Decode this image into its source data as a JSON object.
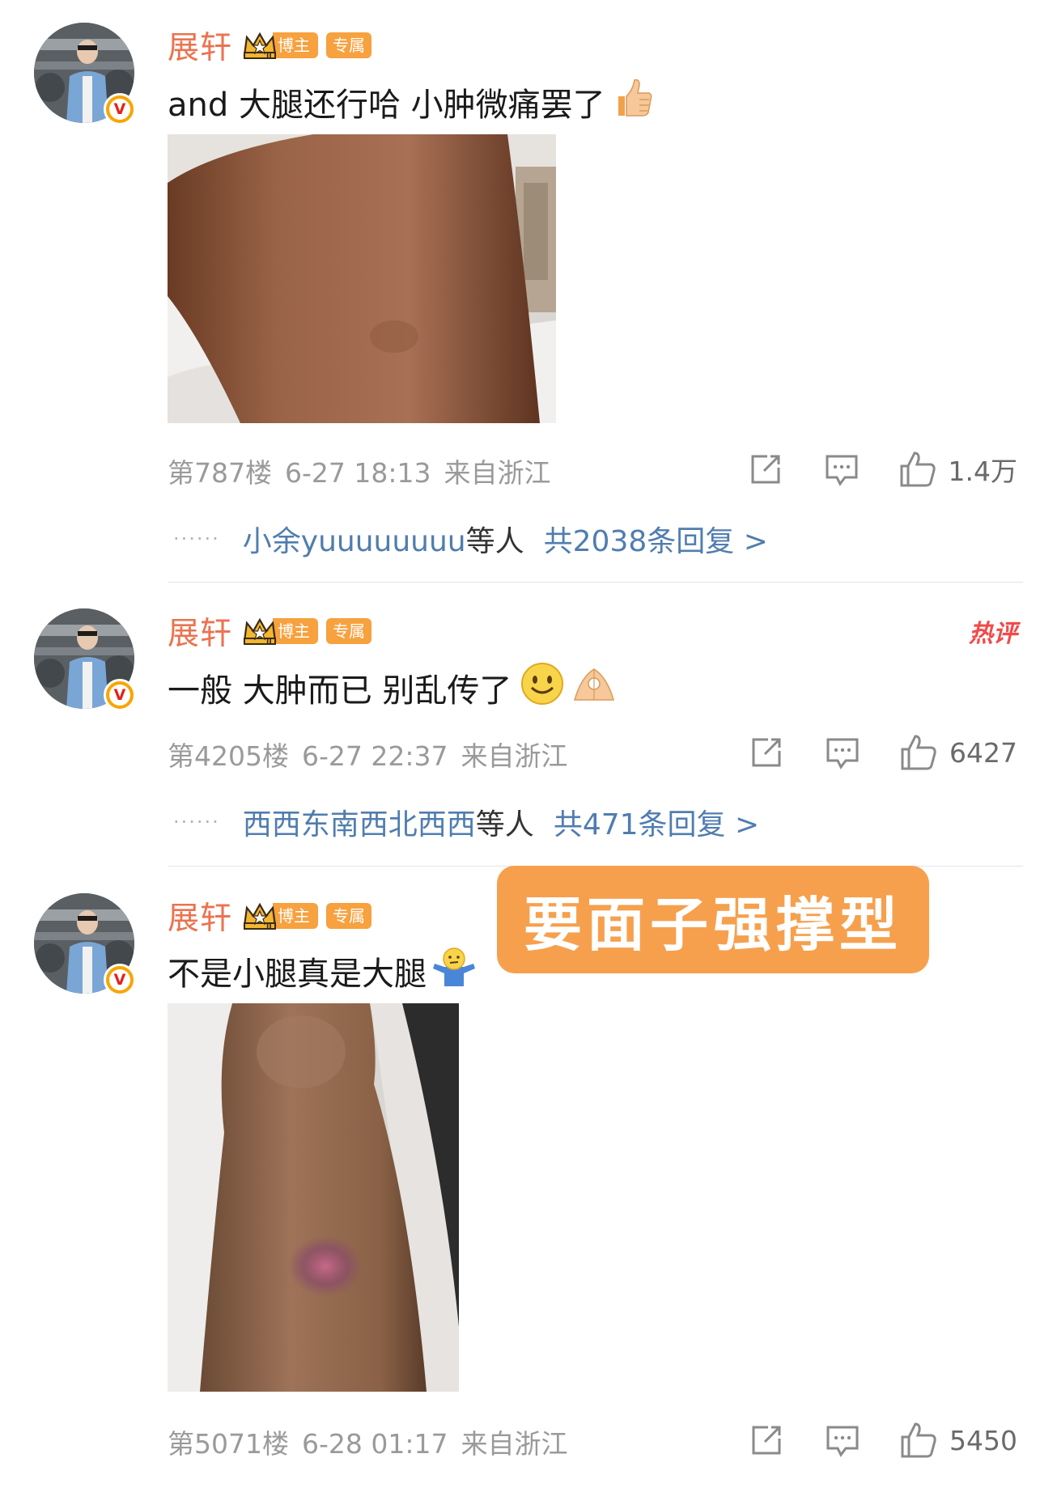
{
  "comments": [
    {
      "username": "展轩",
      "tag_blogger": "博主",
      "tag_exclusive": "专属",
      "text": "and 大腿还行哈 小肿微痛罢了",
      "emoji": "thumbs-up",
      "floor": "第787楼",
      "date": "6-27 18:13",
      "location": "来自浙江",
      "likes": "1.4万",
      "reply_names": "小余yuuuuuuuu",
      "reply_etc": "等人",
      "reply_total": "共2038条回复 >",
      "hot": ""
    },
    {
      "username": "展轩",
      "tag_blogger": "博主",
      "tag_exclusive": "专属",
      "text": "一般 大肿而已 别乱传了",
      "emoji": "smile, ok-hand",
      "floor": "第4205楼",
      "date": "6-27 22:37",
      "location": "来自浙江",
      "likes": "6427",
      "reply_names": "西西东南西北西西",
      "reply_etc": "等人",
      "reply_total": "共471条回复 >",
      "hot": "热评"
    },
    {
      "username": "展轩",
      "tag_blogger": "博主",
      "tag_exclusive": "专属",
      "text": "不是小腿真是大腿",
      "emoji": "shrug",
      "floor": "第5071楼",
      "date": "6-28 01:17",
      "location": "来自浙江",
      "likes": "5450",
      "hot": ""
    }
  ],
  "overlay": {
    "text": "要面子强撑型"
  },
  "colors": {
    "username": "#eb7350",
    "badge": "#f7a13f",
    "link": "#507daf",
    "hot": "#f24a4a",
    "overlay": "#f6a04d"
  }
}
